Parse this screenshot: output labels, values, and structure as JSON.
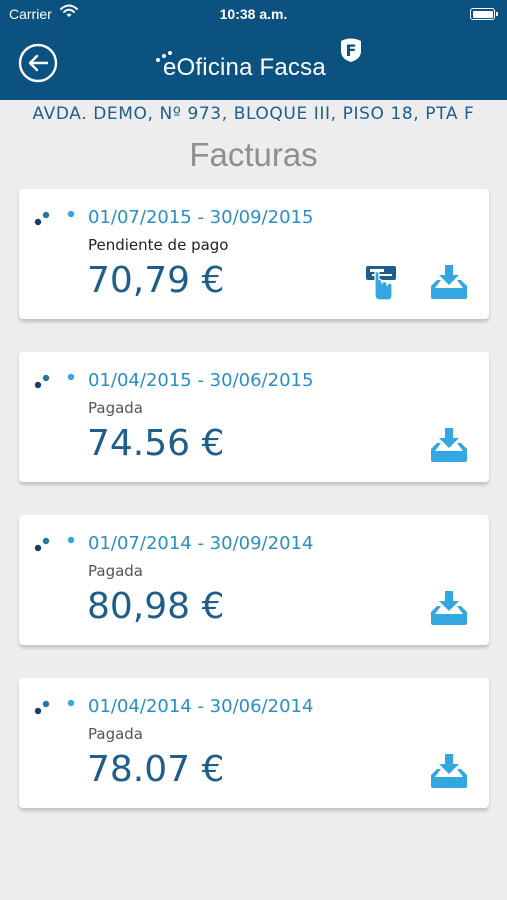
{
  "status_bar": {
    "carrier": "Carrier",
    "time": "10:38 a.m."
  },
  "header": {
    "brand": "eOficina Facsa",
    "brand_logo_letter": "F",
    "back_icon": "back-arrow-icon"
  },
  "address": "AVDA. DEMO, Nº 973, BLOQUE III, PISO 18, PTA F",
  "title": "Facturas",
  "colors": {
    "header_bg": "#0b5280",
    "accent": "#2a8fc4",
    "amount": "#1f5e8a",
    "background": "#ededee"
  },
  "invoices": [
    {
      "period": "01/07/2015 - 30/09/2015",
      "status": "Pendiente de pago",
      "amount": "70,79 €",
      "actions": [
        "pay-icon",
        "download-icon"
      ]
    },
    {
      "period": "01/04/2015 - 30/06/2015",
      "status": "Pagada",
      "amount": "74.56 €",
      "actions": [
        "download-icon"
      ]
    },
    {
      "period": "01/07/2014 - 30/09/2014",
      "status": "Pagada",
      "amount": "80,98 €",
      "actions": [
        "download-icon"
      ]
    },
    {
      "period": "01/04/2014 - 30/06/2014",
      "status": "Pagada",
      "amount": "78.07 €",
      "actions": [
        "download-icon"
      ]
    }
  ]
}
